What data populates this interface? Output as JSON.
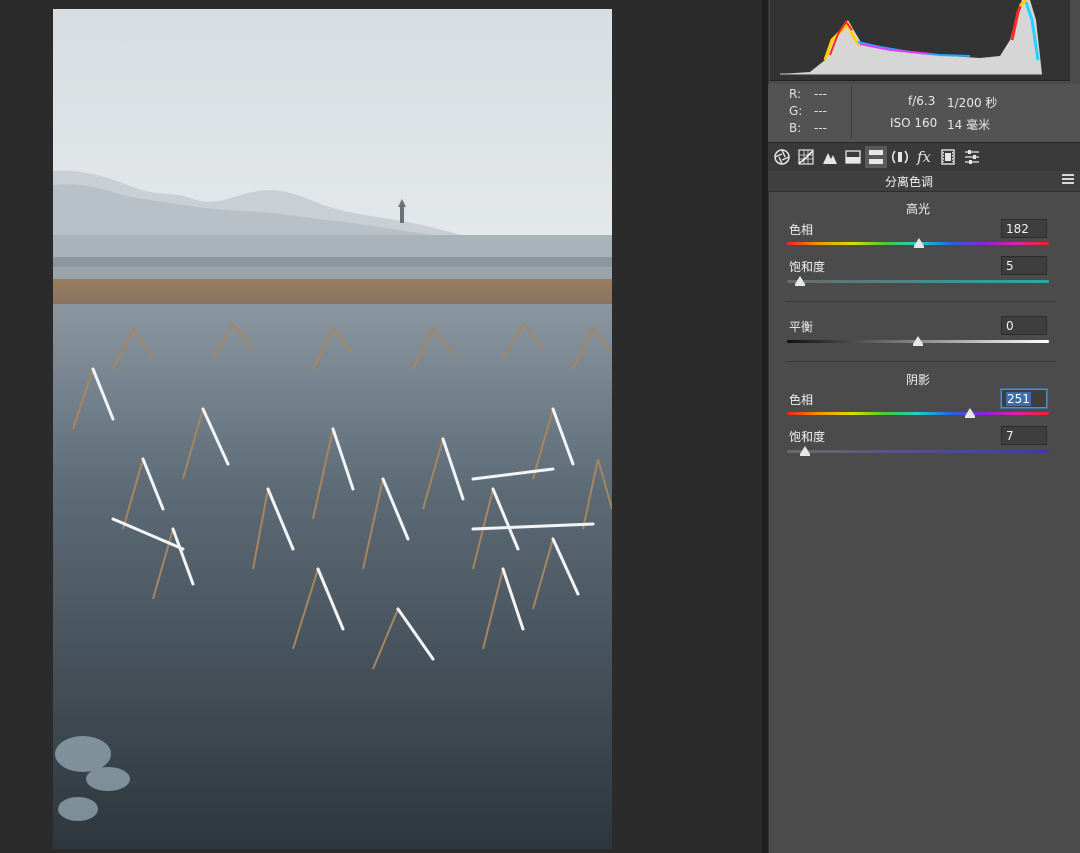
{
  "info": {
    "r_label": "R:",
    "r_value": "---",
    "g_label": "G:",
    "g_value": "---",
    "b_label": "B:",
    "b_value": "---",
    "aperture": "f/6.3",
    "shutter": "1/200 秒",
    "iso": "ISO 160",
    "focal": "14 毫米"
  },
  "toolbar": {
    "tools": [
      "basic-tool",
      "tone-curve-tool",
      "detail-tool",
      "hsl-tool",
      "split-toning-tool",
      "lens-corrections-tool",
      "effects-tool",
      "camera-calibration-tool",
      "presets-tool"
    ],
    "effects_glyph": "fx"
  },
  "panel": {
    "title": "分离色调",
    "highlights": {
      "title": "高光",
      "hue_label": "色相",
      "hue_value": "182",
      "hue_fraction": 0.505,
      "sat_label": "饱和度",
      "sat_value": "5",
      "sat_fraction": 0.05
    },
    "balance": {
      "label": "平衡",
      "value": "0",
      "fraction": 0.5
    },
    "shadows": {
      "title": "阴影",
      "hue_label": "色相",
      "hue_value": "251",
      "hue_fraction": 0.697,
      "sat_label": "饱和度",
      "sat_value": "7",
      "sat_fraction": 0.07
    }
  },
  "colors": {
    "panel_bg": "#4b4b4b",
    "canvas_bg": "#2b2b2b",
    "selection": "#3d6dad"
  }
}
